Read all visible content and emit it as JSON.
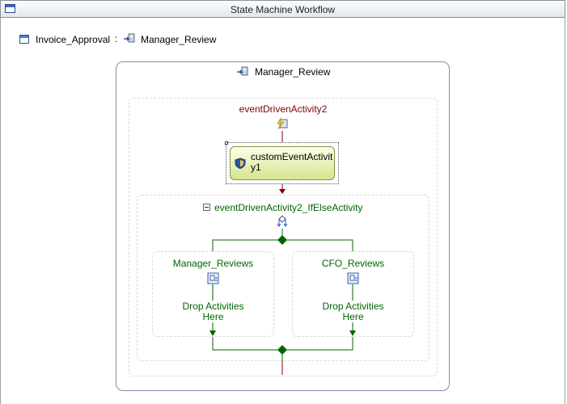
{
  "window": {
    "title": "State Machine Workflow"
  },
  "breadcrumb": {
    "root": "Invoice_Approval",
    "separator": ":",
    "current": "Manager_Review"
  },
  "state": {
    "name": "Manager_Review",
    "event_driven": {
      "name": "eventDrivenActivity2",
      "activity": {
        "label": "customEventActivity1",
        "line1": "customEventActivit",
        "line2": "y1"
      },
      "ifelse": {
        "name": "eventDrivenActivity2_IfElseActivity",
        "branches": [
          {
            "name": "Manager_Reviews",
            "drop_line1": "Drop Activities",
            "drop_line2": "Here"
          },
          {
            "name": "CFO_Reviews",
            "drop_line1": "Drop Activities",
            "drop_line2": "Here"
          }
        ]
      }
    }
  },
  "colors": {
    "event_text": "#800000",
    "branch_text": "#006400",
    "activity_fill": "#e5eea9"
  }
}
